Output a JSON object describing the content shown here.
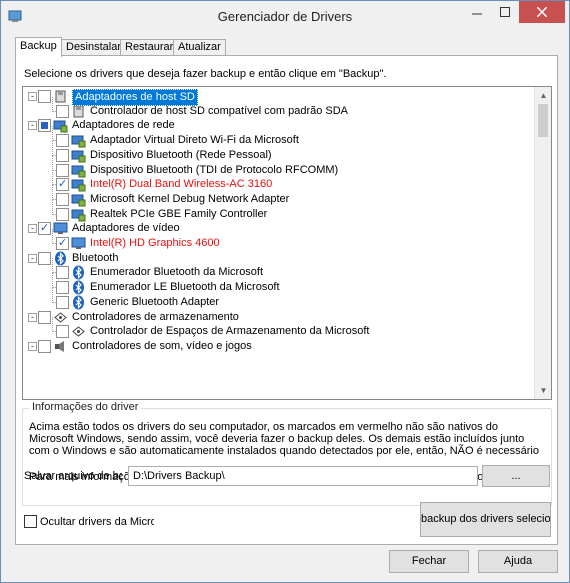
{
  "window": {
    "title": "Gerenciador de Drivers"
  },
  "tabs": [
    {
      "label": "Backup",
      "active": true
    },
    {
      "label": "Desinstalar",
      "active": false
    },
    {
      "label": "Restaurar",
      "active": false
    },
    {
      "label": "Atualizar",
      "active": false
    }
  ],
  "instruction": "Selecione os drivers que deseja fazer backup e então clique em \"Backup\".",
  "tree": [
    {
      "label": "Adaptadores de host SD",
      "level": 0,
      "expander": "-",
      "check": "none",
      "icon": "sd-card-icon",
      "selected": true,
      "red": false
    },
    {
      "label": "Controlador de host SD compatível com padrão SDA",
      "level": 1,
      "check": "none",
      "icon": "sd-card-icon",
      "red": false
    },
    {
      "label": "Adaptadores de rede",
      "level": 0,
      "expander": "-",
      "check": "partial",
      "icon": "network-adapter-icon",
      "red": false
    },
    {
      "label": "Adaptador Virtual Direto Wi-Fi da Microsoft",
      "level": 1,
      "check": "none",
      "icon": "network-adapter-icon",
      "red": false
    },
    {
      "label": "Dispositivo Bluetooth (Rede Pessoal)",
      "level": 1,
      "check": "none",
      "icon": "network-adapter-icon",
      "red": false
    },
    {
      "label": "Dispositivo Bluetooth (TDI de Protocolo RFCOMM)",
      "level": 1,
      "check": "none",
      "icon": "network-adapter-icon",
      "red": false
    },
    {
      "label": "Intel(R) Dual Band Wireless-AC 3160",
      "level": 1,
      "check": "checked",
      "icon": "network-adapter-icon",
      "red": true
    },
    {
      "label": "Microsoft Kernel Debug Network Adapter",
      "level": 1,
      "check": "none",
      "icon": "network-adapter-icon",
      "red": false
    },
    {
      "label": "Realtek PCIe GBE Family Controller",
      "level": 1,
      "check": "none",
      "icon": "network-adapter-icon",
      "red": false
    },
    {
      "label": "Adaptadores de vídeo",
      "level": 0,
      "expander": "-",
      "check": "checked",
      "icon": "monitor-icon",
      "red": false
    },
    {
      "label": "Intel(R) HD Graphics 4600",
      "level": 1,
      "check": "checked",
      "icon": "monitor-icon",
      "red": true
    },
    {
      "label": "Bluetooth",
      "level": 0,
      "expander": "-",
      "check": "none",
      "icon": "bluetooth-icon",
      "red": false
    },
    {
      "label": "Enumerador Bluetooth da Microsoft",
      "level": 1,
      "check": "none",
      "icon": "bluetooth-icon",
      "red": false
    },
    {
      "label": "Enumerador LE Bluetooth da Microsoft",
      "level": 1,
      "check": "none",
      "icon": "bluetooth-icon",
      "red": false
    },
    {
      "label": "Generic Bluetooth Adapter",
      "level": 1,
      "check": "none",
      "icon": "bluetooth-icon",
      "red": false
    },
    {
      "label": "Controladores de armazenamento",
      "level": 0,
      "expander": "-",
      "check": "none",
      "icon": "storage-icon",
      "red": false
    },
    {
      "label": "Controlador de Espaços de Armazenamento da Microsoft",
      "level": 1,
      "check": "none",
      "icon": "storage-icon",
      "red": false
    },
    {
      "label": "Controladores de som, vídeo e jogos",
      "level": 0,
      "expander": "-",
      "check": "none",
      "icon": "speaker-icon",
      "red": false
    }
  ],
  "info": {
    "title": "Informações do driver",
    "text": "Acima estão todos os drivers do seu computador, os marcados em vermelho não são nativos do Microsoft Windows, sendo assim, você deveria fazer o backup deles. Os demais estão incluídos junto com o Windows e são automaticamente instalados quando detectados por ele, então, NÃO é necessário fazer backup deles.",
    "text2": "Para mais informações de cada dispositivo, clique nele que as informações detalhadas serão exibidas."
  },
  "save": {
    "label": "Salvar arquivo de backup em:",
    "path": "D:\\Drivers Backup\\",
    "browse_label": "..."
  },
  "hide_ms": {
    "label": "Ocultar drivers da Microsoft",
    "checked": false
  },
  "backup_button": "backup dos drivers selecionados",
  "footer": {
    "close": "Fechar",
    "help": "Ajuda"
  },
  "colors": {
    "accent": "#0078d7",
    "non_native": "#e81010",
    "close_button": "#c75050"
  }
}
